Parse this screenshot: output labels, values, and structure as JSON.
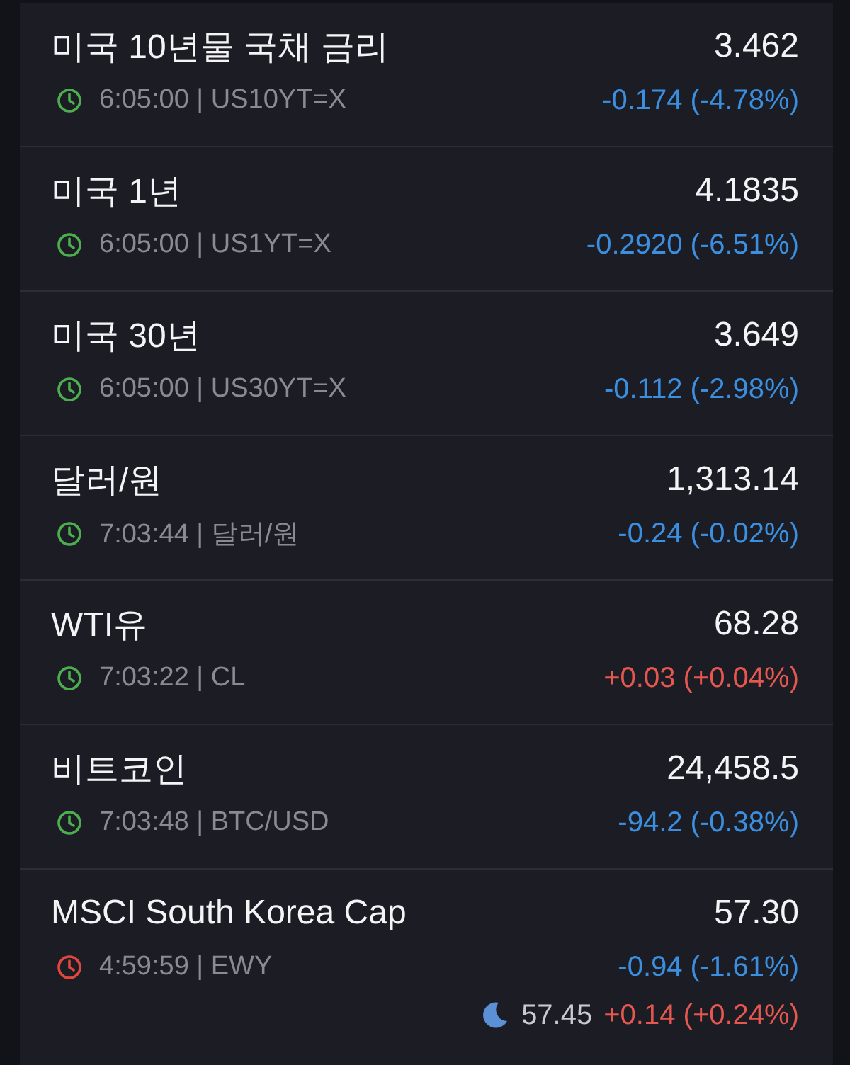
{
  "quotes": [
    {
      "name": "미국 10년물 국채 금리",
      "price": "3.462",
      "meta": "6:05:00 | US10YT=X",
      "market_open": true,
      "change": "-0.174 (-4.78%)",
      "rising": false
    },
    {
      "name": "미국 1년",
      "price": "4.1835",
      "meta": "6:05:00 | US1YT=X",
      "market_open": true,
      "change": "-0.2920 (-6.51%)",
      "rising": false
    },
    {
      "name": "미국 30년",
      "price": "3.649",
      "meta": "6:05:00 | US30YT=X",
      "market_open": true,
      "change": "-0.112 (-2.98%)",
      "rising": false
    },
    {
      "name": "달러/원",
      "price": "1,313.14",
      "meta": "7:03:44 | 달러/원",
      "market_open": true,
      "change": "-0.24 (-0.02%)",
      "rising": false
    },
    {
      "name": "WTI유",
      "price": "68.28",
      "meta": "7:03:22 | CL",
      "market_open": true,
      "change": "+0.03 (+0.04%)",
      "rising": true
    },
    {
      "name": "비트코인",
      "price": "24,458.5",
      "meta": "7:03:48 | BTC/USD",
      "market_open": true,
      "change": "-94.2 (-0.38%)",
      "rising": false
    },
    {
      "name": "MSCI South Korea Cap",
      "price": "57.30",
      "meta": "4:59:59 | EWY",
      "market_open": false,
      "change": "-0.94 (-1.61%)",
      "rising": false,
      "after_hours": {
        "price": "57.45",
        "change": "+0.14 (+0.24%)",
        "rising": true
      }
    }
  ]
}
